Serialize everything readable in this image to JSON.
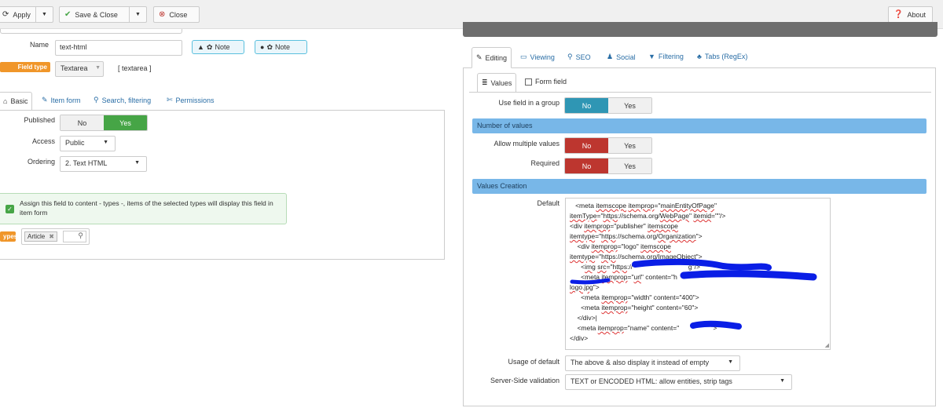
{
  "toolbar": {
    "apply": "Apply",
    "save_close": "Save & Close",
    "close": "Close",
    "about": "About"
  },
  "left": {
    "name_label": "Name",
    "name_value": "text-html",
    "note1": "Note",
    "note2": "Note",
    "field_type_tag": "Field type",
    "field_type_value": "Textarea",
    "field_type_code": "[ textarea ]",
    "tabs": [
      "Basic",
      "Item form",
      "Search, filtering",
      "Permissions"
    ],
    "published_label": "Published",
    "published_no": "No",
    "published_yes": "Yes",
    "access_label": "Access",
    "access_value": "Public",
    "ordering_label": "Ordering",
    "ordering_value": "2. Text HTML",
    "assign_text": "Assign this field to content - types -, items of the selected types will display this field in item form",
    "types_tag": "ypes",
    "types_chip": "Article"
  },
  "right": {
    "tabs": [
      "Editing",
      "Viewing",
      "SEO",
      "Social",
      "Filtering",
      "Tabs (RegEx)"
    ],
    "subtabs": [
      "Values",
      "Form field"
    ],
    "use_group_label": "Use field in a group",
    "use_group_no": "No",
    "use_group_yes": "Yes",
    "section_number": "Number of values",
    "allow_multiple_label": "Allow multiple values",
    "allow_multiple_no": "No",
    "allow_multiple_yes": "Yes",
    "required_label": "Required",
    "required_no": "No",
    "required_yes": "Yes",
    "section_creation": "Values Creation",
    "default_label": "Default",
    "usage_label": "Usage of default",
    "usage_value": "The above & also display it instead of empty",
    "validation_label": "Server-Side validation",
    "validation_value": "TEXT or ENCODED HTML: allow entities, strip tags"
  },
  "colors": {
    "green": "#46a546",
    "red": "#bd362f",
    "blue": "#2f96b4",
    "section": "#78b7e8",
    "orange": "#f0962a"
  }
}
